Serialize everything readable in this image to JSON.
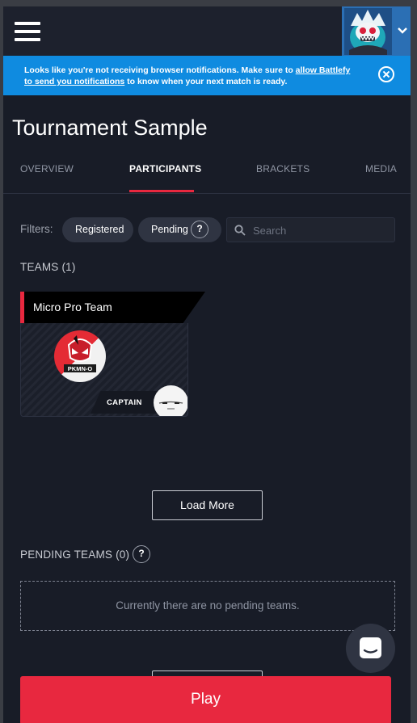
{
  "notice": {
    "text_before": "Looks like you're not receiving browser notifications. Make sure to ",
    "link": "allow Battlefy to send you notifications",
    "text_after": " to know when your next match is ready."
  },
  "page": {
    "title": "Tournament Sample"
  },
  "tabs": [
    {
      "label": "OVERVIEW",
      "active": false
    },
    {
      "label": "PARTICIPANTS",
      "active": true
    },
    {
      "label": "BRACKETS",
      "active": false
    },
    {
      "label": "MEDIA",
      "active": false
    }
  ],
  "filters": {
    "label": "Filters:",
    "registered": "Registered",
    "pending": "Pending",
    "help": "?",
    "search_placeholder": "Search"
  },
  "teams": {
    "heading": "TEAMS (1)",
    "items": [
      {
        "name": "Micro Pro Team",
        "role": "CAPTAIN",
        "logo_text": "PKMN-O"
      }
    ],
    "load_more": "Load More"
  },
  "pending_teams": {
    "heading": "PENDING TEAMS (0)",
    "help": "?",
    "empty_message": "Currently there are no pending teams."
  },
  "play_button": "Play",
  "colors": {
    "accent_red": "#e8283f",
    "banner_blue": "#0f8be0",
    "background": "#181c27"
  }
}
